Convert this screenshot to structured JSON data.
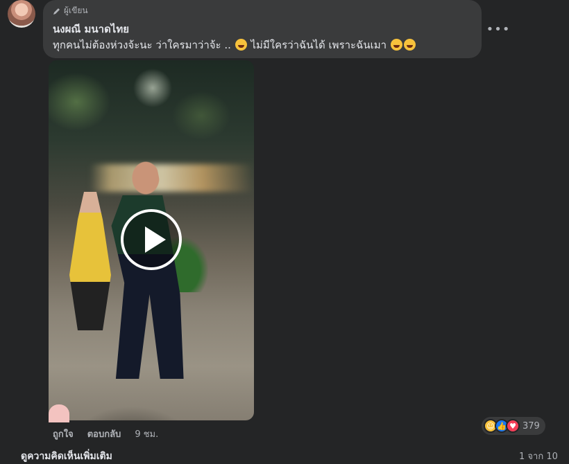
{
  "comment": {
    "author_badge": "ผู้เขียน",
    "author_name": "นงผณี มนาดไทย",
    "text_part1": "ทุกคนไม่ต้องห่วงจ้ะนะ ว่าใครมาว่าจ้ะ ..",
    "text_part2": "ไม่มีใครว่าฉันได้ เพราะฉันเมา",
    "more_label": "•••"
  },
  "actions": {
    "like_label": "ถูกใจ",
    "reply_label": "ตอบกลับ",
    "time_label": "9 ชม."
  },
  "reactions": {
    "count": "379",
    "icons": [
      "haha-icon",
      "like-icon",
      "love-icon"
    ]
  },
  "footer": {
    "next_text": "ดูความคิดเห็นเพิ่มเติม",
    "corner_text": "1 จาก 10"
  },
  "colors": {
    "background": "#242526",
    "bubble": "#3a3b3c",
    "text_primary": "#e4e6eb",
    "text_secondary": "#b0b3b8",
    "like_blue": "#1877f2",
    "love_red": "#f33e58",
    "haha_yellow": "#f7c23c"
  }
}
